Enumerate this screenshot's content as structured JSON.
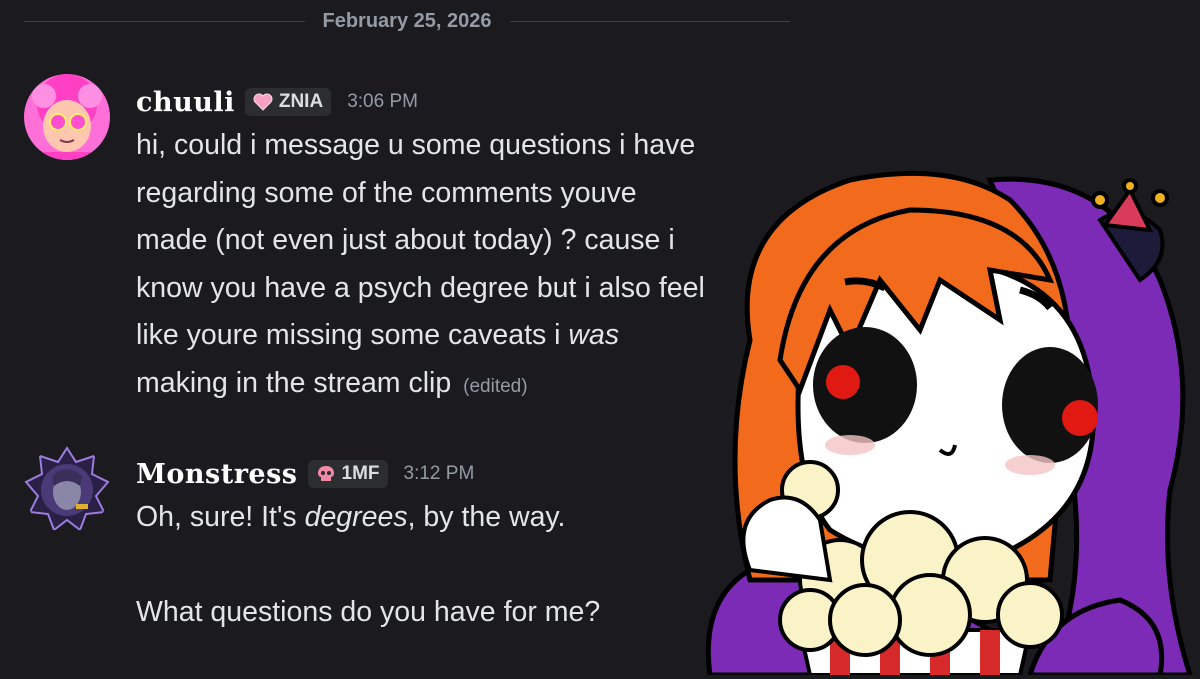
{
  "divider": {
    "date": "February 25, 2026"
  },
  "messages": [
    {
      "username": "chuuli",
      "tag": "ZNIA",
      "time": "3:06 PM",
      "lines": [
        "hi, could i message u some questions i have",
        "regarding some of the comments youve",
        "made (not even just about today) ? cause i",
        "know you have a psych degree but i also feel",
        "like youre missing some caveats i ",
        "making in the stream clip"
      ],
      "emphasis": "was",
      "edited": "(edited)",
      "avatar_color": "#ff5ad1"
    },
    {
      "username": "Monstress",
      "tag": "1MF",
      "time": "3:12 PM",
      "line1_pre": "Oh, sure! It's ",
      "line1_em": "degrees",
      "line1_post": ", by the way.",
      "line2": "What questions do you have for me?",
      "avatar_color": "#6a4fa3"
    }
  ],
  "icons": {
    "tag1": "heart-icon",
    "tag2": "skull-icon",
    "sticker": "popcorn-jester-sticker"
  },
  "colors": {
    "background": "#1b1b1f",
    "text": "#e3e5e8",
    "muted": "#949ba4"
  }
}
